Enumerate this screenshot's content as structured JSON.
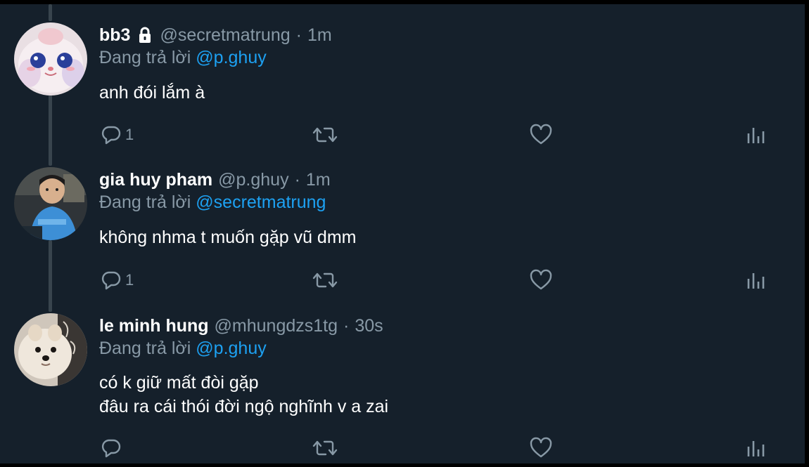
{
  "replies": [
    {
      "name": "bb3",
      "locked": true,
      "handle": "@secretmatrung",
      "separator": "·",
      "time": "1m",
      "reply_prefix": "Đang trả lời",
      "reply_to": "@p.ghuy",
      "text_lines": [
        "anh đói lắm à"
      ],
      "reply_count": "1"
    },
    {
      "name": "gia huy pham",
      "locked": false,
      "handle": "@p.ghuy",
      "separator": "·",
      "time": "1m",
      "reply_prefix": "Đang trả lời",
      "reply_to": "@secretmatrung",
      "text_lines": [
        "không nhma t muốn gặp vũ dmm"
      ],
      "reply_count": "1"
    },
    {
      "name": "le minh hung",
      "locked": false,
      "handle": "@mhungdzs1tg",
      "separator": "·",
      "time": "30s",
      "reply_prefix": "Đang trả lời",
      "reply_to": "@p.ghuy",
      "text_lines": [
        "có k giữ mất đòi gặp",
        "đâu ra cái thói đời ngộ nghĩnh v a zai"
      ],
      "reply_count": ""
    }
  ],
  "icons": {
    "reply": "reply-icon",
    "retweet": "retweet-icon",
    "like": "heart-icon",
    "analytics": "analytics-icon",
    "lock": "lock-icon"
  },
  "colors": {
    "background": "#15202b",
    "secondary_text": "#8899a6",
    "mention": "#1da1f2",
    "thread_line": "#38444d"
  }
}
